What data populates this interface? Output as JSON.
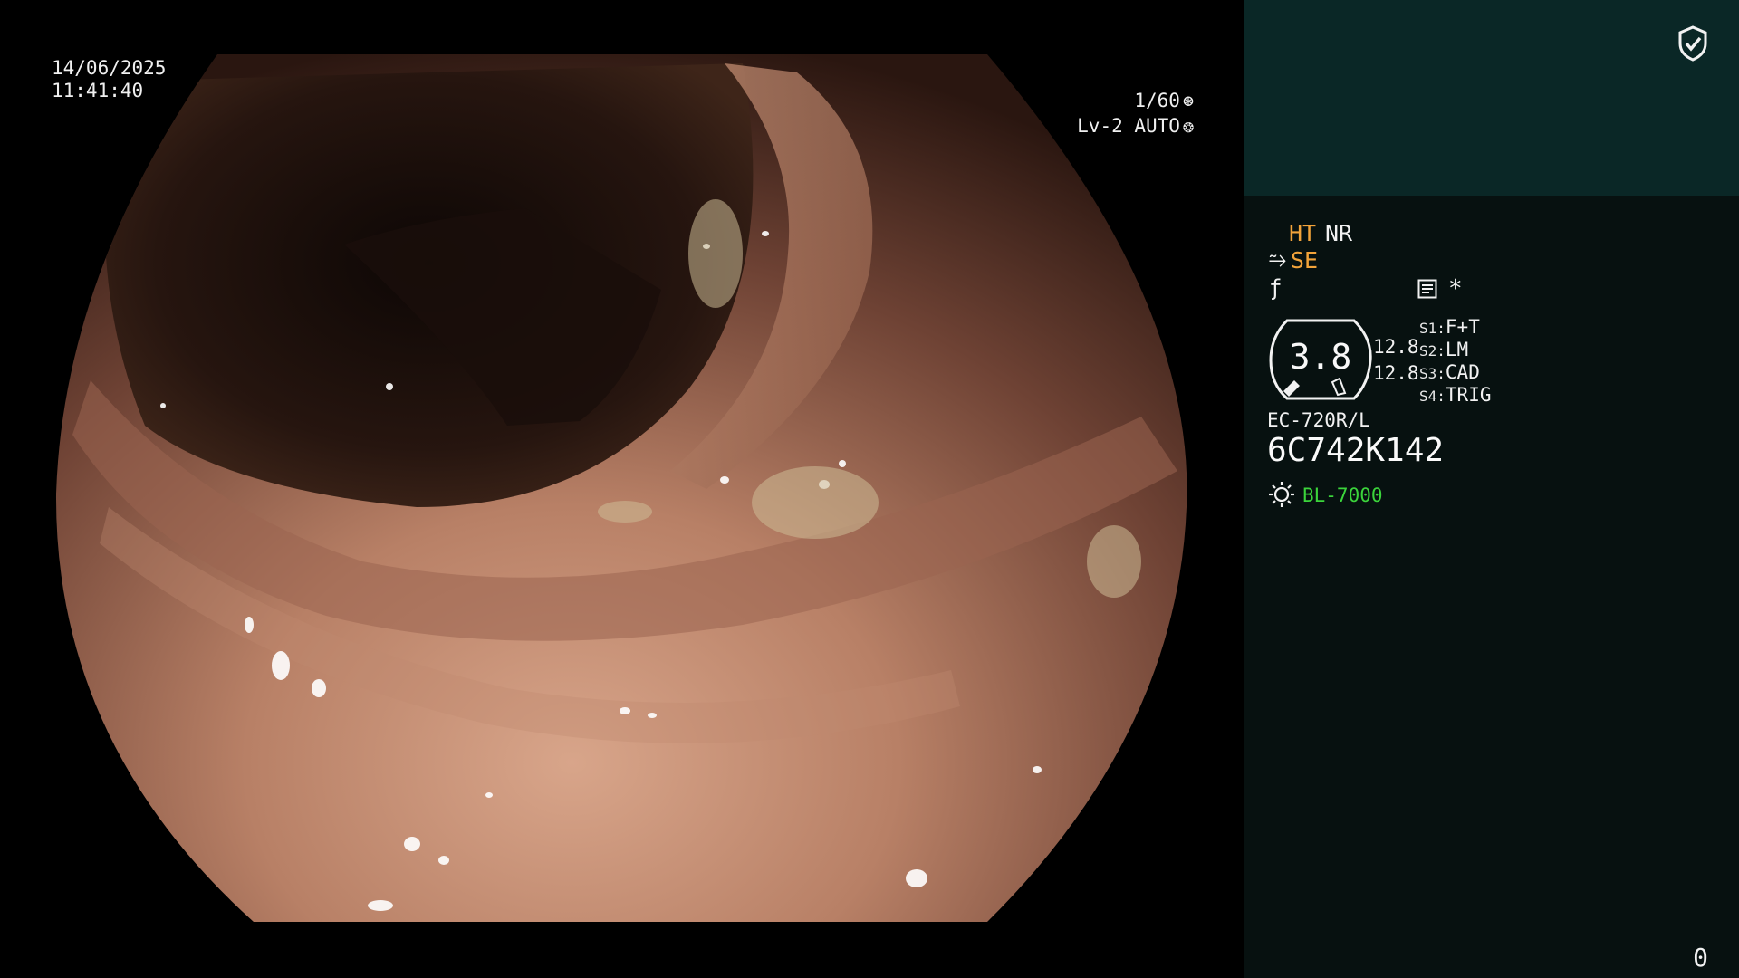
{
  "overlay": {
    "date": "14/06/2025",
    "time": "11:41:40",
    "shutter": "1/60",
    "shutter_icon": "aperture-icon",
    "iris_level": "Lv-2 AUTO",
    "iris_icon": "iris-icon"
  },
  "panel": {
    "top_icon": "shield-check-icon",
    "enhance_label": "HT",
    "noise_label": "NR",
    "structure_icon": "se-icon",
    "structure_label": "SE",
    "fstop_icon": "f-stop-icon",
    "memo_icon": "memo-icon",
    "asterisk": "*",
    "gauge": {
      "value": "3.8",
      "right_top": "12.8",
      "right_bottom": "12.8"
    },
    "switches": [
      {
        "key": "S1:",
        "value": "F+T"
      },
      {
        "key": "S2:",
        "value": "LM"
      },
      {
        "key": "S3:",
        "value": "CAD"
      },
      {
        "key": "S4:",
        "value": "TRIG"
      }
    ],
    "scope_model": "EC-720R/L",
    "scope_serial": "6C742K142",
    "light_icon": "lamp-icon",
    "light_source": "BL-7000",
    "counter": "0"
  },
  "colors": {
    "accent_orange": "#f2a33a",
    "accent_green": "#3bd43b",
    "panel_top": "#0a2726",
    "panel_body": "#071110"
  }
}
